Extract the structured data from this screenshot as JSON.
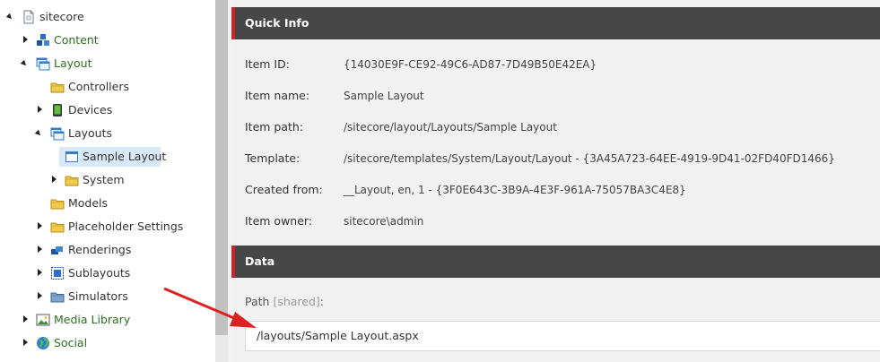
{
  "tree": {
    "root": "sitecore",
    "content": "Content",
    "layout": "Layout",
    "controllers": "Controllers",
    "devices": "Devices",
    "layouts": "Layouts",
    "sample_layout": "Sample Layout",
    "system": "System",
    "models": "Models",
    "placeholder_settings": "Placeholder Settings",
    "renderings": "Renderings",
    "sublayouts": "Sublayouts",
    "simulators": "Simulators",
    "media_library": "Media Library",
    "social": "Social"
  },
  "quick_info": {
    "title": "Quick Info",
    "rows": [
      {
        "label": "Item ID:",
        "value": "{14030E9F-CE92-49C6-AD87-7D49B50E42EA}"
      },
      {
        "label": "Item name:",
        "value": "Sample Layout"
      },
      {
        "label": "Item path:",
        "value": "/sitecore/layout/Layouts/Sample Layout"
      },
      {
        "label": "Template:",
        "value": "/sitecore/templates/System/Layout/Layout - {3A45A723-64EE-4919-9D41-02FD40FD1466}"
      },
      {
        "label": "Created from:",
        "value": "__Layout, en, 1 - {3F0E643C-3B9A-4E3F-961A-75057BA3C4E8}"
      },
      {
        "label": "Item owner:",
        "value": "sitecore\\admin"
      }
    ]
  },
  "data_section": {
    "title": "Data",
    "path_label": "Path",
    "path_shared": "[shared]",
    "path_colon": ":",
    "path_value": "/layouts/Sample Layout.aspx"
  },
  "colors": {
    "header_bg": "#474747",
    "header_accent": "#c8262f",
    "tree_label_green": "#2b6f1f",
    "selected_bg": "#d9e8f6",
    "annotation_arrow": "#e02020"
  }
}
